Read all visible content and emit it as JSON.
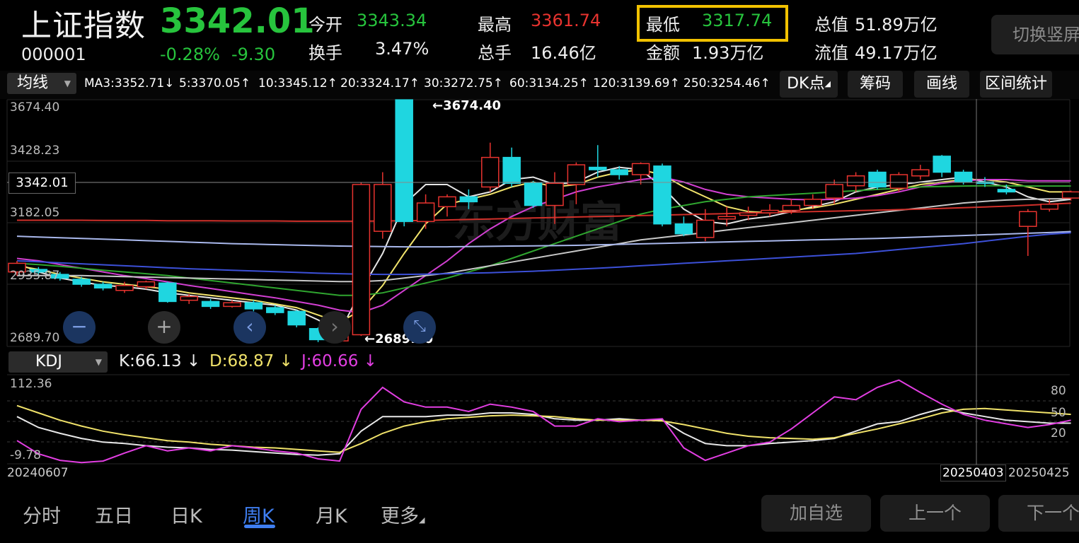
{
  "header": {
    "name": "上证指数",
    "code": "000001",
    "price": "3342.01",
    "change_pct": "-0.28%",
    "change_abs": "-9.30",
    "stats": [
      {
        "label": "今开",
        "value": "3343.34",
        "color": "green"
      },
      {
        "label": "最高",
        "value": "3361.74",
        "color": "red"
      },
      {
        "label": "最低",
        "value": "3317.74",
        "color": "green",
        "highlighted": true
      },
      {
        "label": "总值",
        "value": "51.89万亿",
        "color": "white"
      },
      {
        "label": "换手",
        "value": "3.47%",
        "color": "white"
      },
      {
        "label": "总手",
        "value": "16.46亿",
        "color": "white"
      },
      {
        "label": "金额",
        "value": "1.93万亿",
        "color": "white"
      },
      {
        "label": "流值",
        "value": "49.17万亿",
        "color": "white"
      }
    ],
    "switch_label": "切换竖屏"
  },
  "toolbar": {
    "indicator_select": "均线",
    "ma_values": [
      {
        "text": "MA3:3352.71↓",
        "color": "#e6e6e6"
      },
      {
        "text": "5:3370.05↑",
        "color": "#f2e46c"
      },
      {
        "text": "10:3345.12↑",
        "color": "#d23fd2"
      },
      {
        "text": "20:3324.17↑",
        "color": "#2fa52f"
      },
      {
        "text": "30:3272.75↑",
        "color": "#c8c8c8"
      },
      {
        "text": "60:3134.25↑",
        "color": "#3c50d8"
      },
      {
        "text": "120:3139.69↑",
        "color": "#a9b8ec"
      },
      {
        "text": "250:3254.46↑",
        "color": "#d0302a"
      }
    ],
    "buttons": [
      "DK点",
      "筹码",
      "画线",
      "区间统计"
    ]
  },
  "main_chart": {
    "y_labels": [
      "3674.40",
      "3428.23",
      "3182.05",
      "2935.87",
      "2689.70"
    ],
    "current_price_tag": "3342.01",
    "max_marker": "3674.40",
    "min_marker": "2689.70",
    "watermark": "东方财富"
  },
  "kdj": {
    "select": "KDJ",
    "k": "K:66.13",
    "d": "D:68.87",
    "j": "J:60.66",
    "y_top": "112.36",
    "y_bottom": "-9.78",
    "right_levels": [
      "80",
      "50",
      "20"
    ]
  },
  "date_axis": {
    "start": "20240607",
    "cursor": "20250403",
    "end": "20250425"
  },
  "chart_data": {
    "type": "candlestick",
    "price_range": [
      2689.7,
      3674.4
    ],
    "candles": [
      {
        "o": 2975,
        "c": 3010,
        "h": 3020,
        "l": 2960
      },
      {
        "o": 2985,
        "c": 2975,
        "h": 2995,
        "l": 2960
      },
      {
        "o": 2965,
        "c": 2950,
        "h": 2975,
        "l": 2940
      },
      {
        "o": 2945,
        "c": 2925,
        "h": 2955,
        "l": 2915
      },
      {
        "o": 2925,
        "c": 2910,
        "h": 2935,
        "l": 2900
      },
      {
        "o": 2900,
        "c": 2920,
        "h": 2935,
        "l": 2890
      },
      {
        "o": 2915,
        "c": 2935,
        "h": 2940,
        "l": 2905
      },
      {
        "o": 2930,
        "c": 2855,
        "h": 2935,
        "l": 2850
      },
      {
        "o": 2860,
        "c": 2875,
        "h": 2885,
        "l": 2845
      },
      {
        "o": 2855,
        "c": 2835,
        "h": 2865,
        "l": 2825
      },
      {
        "o": 2835,
        "c": 2850,
        "h": 2860,
        "l": 2830
      },
      {
        "o": 2850,
        "c": 2825,
        "h": 2860,
        "l": 2815
      },
      {
        "o": 2830,
        "c": 2810,
        "h": 2840,
        "l": 2800
      },
      {
        "o": 2815,
        "c": 2760,
        "h": 2820,
        "l": 2750
      },
      {
        "o": 2745,
        "c": 2700,
        "h": 2750,
        "l": 2690
      },
      {
        "o": 2695,
        "c": 2720,
        "h": 2735,
        "l": 2690
      },
      {
        "o": 2720,
        "c": 3330,
        "h": 3340,
        "l": 2715
      },
      {
        "o": 3140,
        "c": 3330,
        "h": 3380,
        "l": 3110
      },
      {
        "o": 3674,
        "c": 3180,
        "h": 3674,
        "l": 3160
      },
      {
        "o": 3180,
        "c": 3255,
        "h": 3290,
        "l": 3150
      },
      {
        "o": 3240,
        "c": 3280,
        "h": 3290,
        "l": 3200
      },
      {
        "o": 3280,
        "c": 3260,
        "h": 3310,
        "l": 3230
      },
      {
        "o": 3320,
        "c": 3440,
        "h": 3500,
        "l": 3300
      },
      {
        "o": 3440,
        "c": 3335,
        "h": 3480,
        "l": 3320
      },
      {
        "o": 3335,
        "c": 3245,
        "h": 3345,
        "l": 3235
      },
      {
        "o": 3245,
        "c": 3335,
        "h": 3380,
        "l": 3170
      },
      {
        "o": 3330,
        "c": 3410,
        "h": 3420,
        "l": 3250
      },
      {
        "o": 3400,
        "c": 3390,
        "h": 3490,
        "l": 3360
      },
      {
        "o": 3390,
        "c": 3370,
        "h": 3405,
        "l": 3350
      },
      {
        "o": 3370,
        "c": 3415,
        "h": 3420,
        "l": 3330
      },
      {
        "o": 3405,
        "c": 3170,
        "h": 3415,
        "l": 3160
      },
      {
        "o": 3170,
        "c": 3130,
        "h": 3200,
        "l": 3120
      },
      {
        "o": 3115,
        "c": 3185,
        "h": 3230,
        "l": 3100
      },
      {
        "o": 3190,
        "c": 3200,
        "h": 3240,
        "l": 3160
      },
      {
        "o": 3205,
        "c": 3215,
        "h": 3240,
        "l": 3185
      },
      {
        "o": 3215,
        "c": 3225,
        "h": 3250,
        "l": 3200
      },
      {
        "o": 3225,
        "c": 3245,
        "h": 3270,
        "l": 3210
      },
      {
        "o": 3245,
        "c": 3270,
        "h": 3290,
        "l": 3230
      },
      {
        "o": 3275,
        "c": 3330,
        "h": 3350,
        "l": 3250
      },
      {
        "o": 3325,
        "c": 3365,
        "h": 3380,
        "l": 3300
      },
      {
        "o": 3380,
        "c": 3320,
        "h": 3390,
        "l": 3310
      },
      {
        "o": 3315,
        "c": 3370,
        "h": 3380,
        "l": 3300
      },
      {
        "o": 3365,
        "c": 3390,
        "h": 3410,
        "l": 3350
      },
      {
        "o": 3445,
        "c": 3380,
        "h": 3450,
        "l": 3360
      },
      {
        "o": 3380,
        "c": 3340,
        "h": 3390,
        "l": 3330
      },
      {
        "o": 3340,
        "c": 3335,
        "h": 3360,
        "l": 3320
      },
      {
        "o": 3310,
        "c": 3300,
        "h": 3330,
        "l": 3290
      },
      {
        "o": 3160,
        "c": 3220,
        "h": 3230,
        "l": 3040
      },
      {
        "o": 3230,
        "c": 3250,
        "h": 3270,
        "l": 3220
      },
      {
        "o": 3275,
        "c": 3300,
        "h": 3305,
        "l": 3265
      }
    ],
    "ma_series": [
      {
        "name": "MA3",
        "color": "#e6e6e6",
        "values": [
          3010,
          2975,
          2950,
          2935,
          2920,
          2915,
          2905,
          2890,
          2880,
          2870,
          2860,
          2850,
          2840,
          2820,
          2780,
          2730,
          2900,
          3050,
          3250,
          3330,
          3330,
          3280,
          3300,
          3350,
          3360,
          3330,
          3340,
          3380,
          3400,
          3390,
          3320,
          3230,
          3180,
          3170,
          3190,
          3200,
          3220,
          3240,
          3260,
          3300,
          3320,
          3330,
          3340,
          3350,
          3360,
          3340,
          3320,
          3280,
          3260,
          3270
        ]
      },
      {
        "name": "5",
        "color": "#f2e46c",
        "values": [
          3000,
          2985,
          2965,
          2950,
          2935,
          2925,
          2915,
          2905,
          2890,
          2880,
          2870,
          2860,
          2845,
          2830,
          2800,
          2770,
          2820,
          2920,
          3050,
          3170,
          3250,
          3270,
          3290,
          3320,
          3340,
          3320,
          3330,
          3360,
          3380,
          3390,
          3370,
          3320,
          3280,
          3240,
          3220,
          3215,
          3225,
          3235,
          3250,
          3270,
          3290,
          3310,
          3330,
          3340,
          3350,
          3350,
          3340,
          3320,
          3300,
          3300
        ]
      },
      {
        "name": "10",
        "color": "#d23fd2",
        "values": [
          3030,
          3020,
          3005,
          2990,
          2975,
          2960,
          2948,
          2935,
          2920,
          2908,
          2895,
          2882,
          2870,
          2855,
          2840,
          2820,
          2810,
          2840,
          2900,
          2960,
          3020,
          3090,
          3150,
          3200,
          3240,
          3270,
          3300,
          3320,
          3335,
          3350,
          3360,
          3340,
          3310,
          3290,
          3280,
          3275,
          3270,
          3268,
          3270,
          3275,
          3285,
          3300,
          3320,
          3335,
          3345,
          3350,
          3350,
          3345,
          3345,
          3345
        ]
      },
      {
        "name": "20",
        "color": "#2fa52f",
        "values": [
          3010,
          3005,
          2998,
          2990,
          2982,
          2975,
          2968,
          2960,
          2950,
          2940,
          2930,
          2920,
          2910,
          2900,
          2890,
          2880,
          2880,
          2890,
          2910,
          2930,
          2950,
          2975,
          3000,
          3030,
          3060,
          3090,
          3120,
          3150,
          3180,
          3210,
          3230,
          3245,
          3260,
          3270,
          3280,
          3285,
          3290,
          3295,
          3300,
          3305,
          3310,
          3315,
          3320,
          3322,
          3324,
          3325,
          3325,
          3324,
          3324,
          3324
        ]
      },
      {
        "name": "30",
        "color": "#c8c8c8",
        "values": [
          2960,
          2960,
          2960,
          2960,
          2958,
          2956,
          2954,
          2952,
          2950,
          2948,
          2946,
          2944,
          2942,
          2940,
          2938,
          2936,
          2936,
          2940,
          2950,
          2960,
          2970,
          2985,
          3000,
          3015,
          3030,
          3045,
          3060,
          3075,
          3090,
          3105,
          3115,
          3125,
          3135,
          3145,
          3155,
          3165,
          3175,
          3185,
          3195,
          3205,
          3215,
          3225,
          3235,
          3245,
          3255,
          3262,
          3267,
          3270,
          3272,
          3272
        ]
      },
      {
        "name": "60",
        "color": "#3c50d8",
        "values": [
          3020,
          3016,
          3012,
          3008,
          3004,
          3000,
          2996,
          2992,
          2988,
          2985,
          2982,
          2979,
          2976,
          2973,
          2970,
          2968,
          2966,
          2965,
          2965,
          2966,
          2968,
          2970,
          2972,
          2975,
          2978,
          2982,
          2986,
          2990,
          2995,
          3000,
          3005,
          3010,
          3015,
          3020,
          3025,
          3030,
          3035,
          3040,
          3045,
          3050,
          3058,
          3066,
          3074,
          3082,
          3090,
          3100,
          3110,
          3120,
          3128,
          3134
        ]
      },
      {
        "name": "120",
        "color": "#a9b8ec",
        "values": [
          3120,
          3117,
          3114,
          3111,
          3108,
          3105,
          3102,
          3099,
          3096,
          3093,
          3090,
          3088,
          3086,
          3084,
          3082,
          3080,
          3079,
          3078,
          3077,
          3077,
          3077,
          3078,
          3079,
          3080,
          3081,
          3082,
          3083,
          3085,
          3087,
          3089,
          3091,
          3093,
          3095,
          3097,
          3099,
          3101,
          3103,
          3105,
          3107,
          3109,
          3111,
          3114,
          3117,
          3120,
          3123,
          3126,
          3129,
          3132,
          3135,
          3139
        ]
      },
      {
        "name": "250",
        "color": "#d0302a",
        "values": [
          3185,
          3185,
          3185,
          3185,
          3184,
          3184,
          3184,
          3183,
          3183,
          3183,
          3182,
          3182,
          3182,
          3181,
          3181,
          3181,
          3181,
          3182,
          3183,
          3184,
          3186,
          3188,
          3190,
          3192,
          3194,
          3196,
          3198,
          3200,
          3202,
          3204,
          3206,
          3208,
          3210,
          3212,
          3214,
          3216,
          3218,
          3220,
          3222,
          3224,
          3226,
          3228,
          3230,
          3233,
          3236,
          3239,
          3242,
          3246,
          3250,
          3254
        ]
      }
    ],
    "kdj_range": [
      -9.78,
      112.36
    ],
    "kdj_series": [
      {
        "name": "K",
        "color": "#e8e8e8",
        "values": [
          55,
          40,
          32,
          25,
          20,
          18,
          15,
          13,
          12,
          10,
          9,
          7,
          5,
          3,
          2,
          4,
          35,
          55,
          55,
          55,
          57,
          57,
          60,
          60,
          58,
          52,
          50,
          50,
          52,
          50,
          50,
          32,
          18,
          15,
          15,
          18,
          20,
          22,
          25,
          35,
          45,
          48,
          58,
          66,
          60,
          55,
          50,
          48,
          46,
          46
        ]
      },
      {
        "name": "D",
        "color": "#f0e26a",
        "values": [
          70,
          60,
          50,
          42,
          35,
          30,
          26,
          22,
          20,
          17,
          15,
          13,
          12,
          10,
          8,
          6,
          18,
          32,
          42,
          48,
          52,
          54,
          56,
          57,
          56,
          55,
          52,
          50,
          50,
          50,
          49,
          44,
          38,
          32,
          28,
          26,
          25,
          24,
          26,
          32,
          38,
          45,
          52,
          60,
          65,
          66,
          64,
          62,
          60,
          58
        ]
      },
      {
        "name": "J",
        "color": "#e23ee2",
        "values": [
          22,
          4,
          -5,
          -8,
          -6,
          5,
          15,
          8,
          12,
          8,
          15,
          12,
          8,
          5,
          -3,
          -6,
          65,
          95,
          75,
          68,
          68,
          62,
          72,
          68,
          62,
          42,
          42,
          52,
          48,
          50,
          52,
          12,
          -5,
          5,
          15,
          20,
          38,
          60,
          82,
          78,
          95,
          105,
          88,
          72,
          58,
          50,
          45,
          40,
          44,
          50
        ]
      }
    ]
  }
}
